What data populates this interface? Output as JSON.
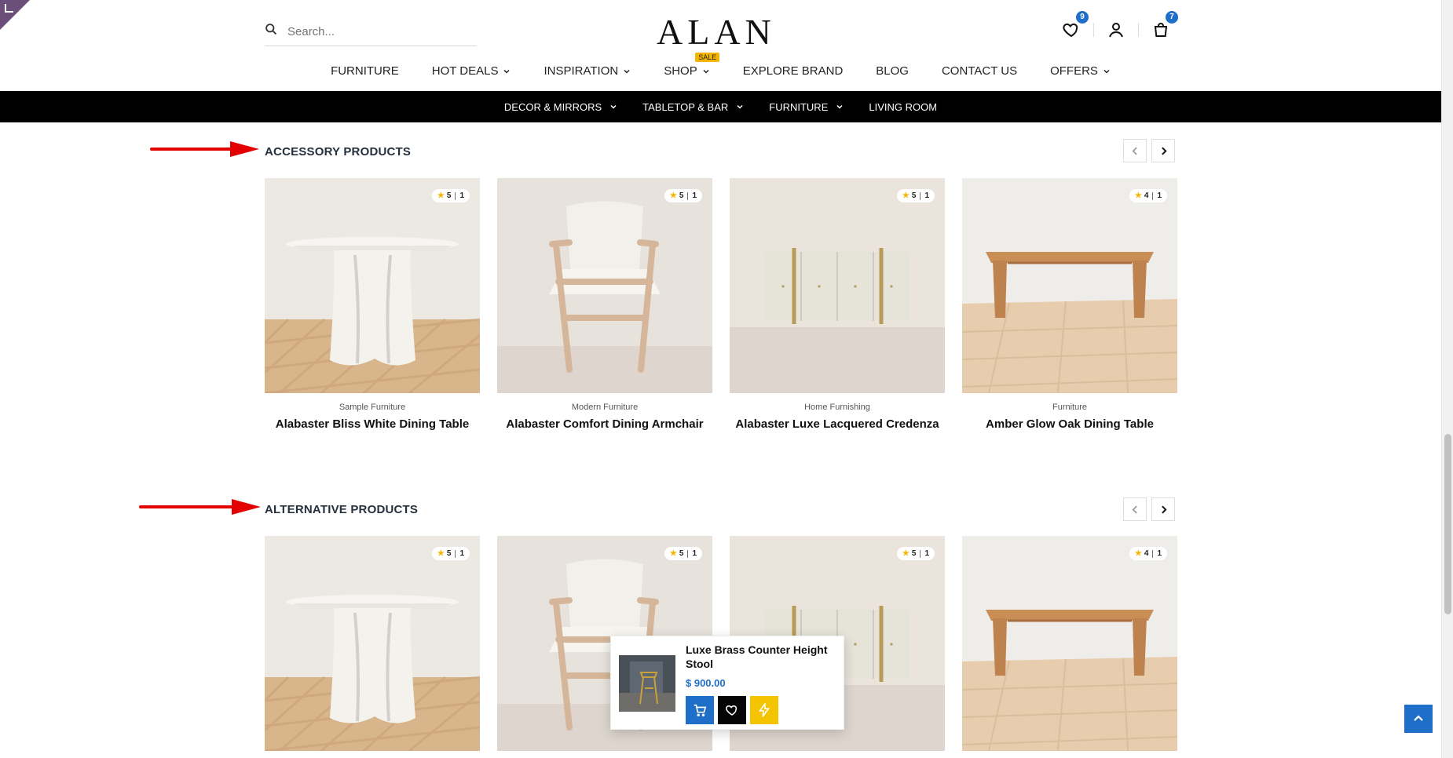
{
  "header": {
    "search_placeholder": "Search...",
    "logo": "ALAN",
    "wishlist_count": "9",
    "cart_count": "7"
  },
  "nav": {
    "items": [
      {
        "label": "FURNITURE"
      },
      {
        "label": "HOT DEALS"
      },
      {
        "label": "INSPIRATION"
      },
      {
        "label": "SHOP"
      },
      {
        "label": "EXPLORE BRAND"
      },
      {
        "label": "BLOG"
      },
      {
        "label": "CONTACT US"
      },
      {
        "label": "OFFERS"
      }
    ],
    "sale_label": "SALE"
  },
  "subnav": {
    "items": [
      {
        "label": "DECOR & MIRRORS"
      },
      {
        "label": "TABLETOP & BAR"
      },
      {
        "label": "FURNITURE"
      },
      {
        "label": "LIVING ROOM"
      }
    ]
  },
  "sections": [
    {
      "title": "ACCESSORY PRODUCTS",
      "products": [
        {
          "rating": "5",
          "reviews": "1",
          "category": "Sample Furniture",
          "name": "Alabaster Bliss White Dining Table"
        },
        {
          "rating": "5",
          "reviews": "1",
          "category": "Modern Furniture",
          "name": "Alabaster Comfort Dining Armchair"
        },
        {
          "rating": "5",
          "reviews": "1",
          "category": "Home Furnishing",
          "name": "Alabaster Luxe Lacquered Credenza"
        },
        {
          "rating": "4",
          "reviews": "1",
          "category": "Furniture",
          "name": "Amber Glow Oak Dining Table"
        }
      ]
    },
    {
      "title": "ALTERNATIVE PRODUCTS",
      "products": [
        {
          "rating": "5",
          "reviews": "1"
        },
        {
          "rating": "5",
          "reviews": "1"
        },
        {
          "rating": "5",
          "reviews": "1"
        },
        {
          "rating": "4",
          "reviews": "1"
        }
      ]
    }
  ],
  "popup": {
    "name": "Luxe Brass Counter Height Stool",
    "price": "$ 900.00"
  },
  "colors": {
    "accent": "#1f6fc9",
    "arrow": "#e30000",
    "quick": "#f5c400"
  }
}
